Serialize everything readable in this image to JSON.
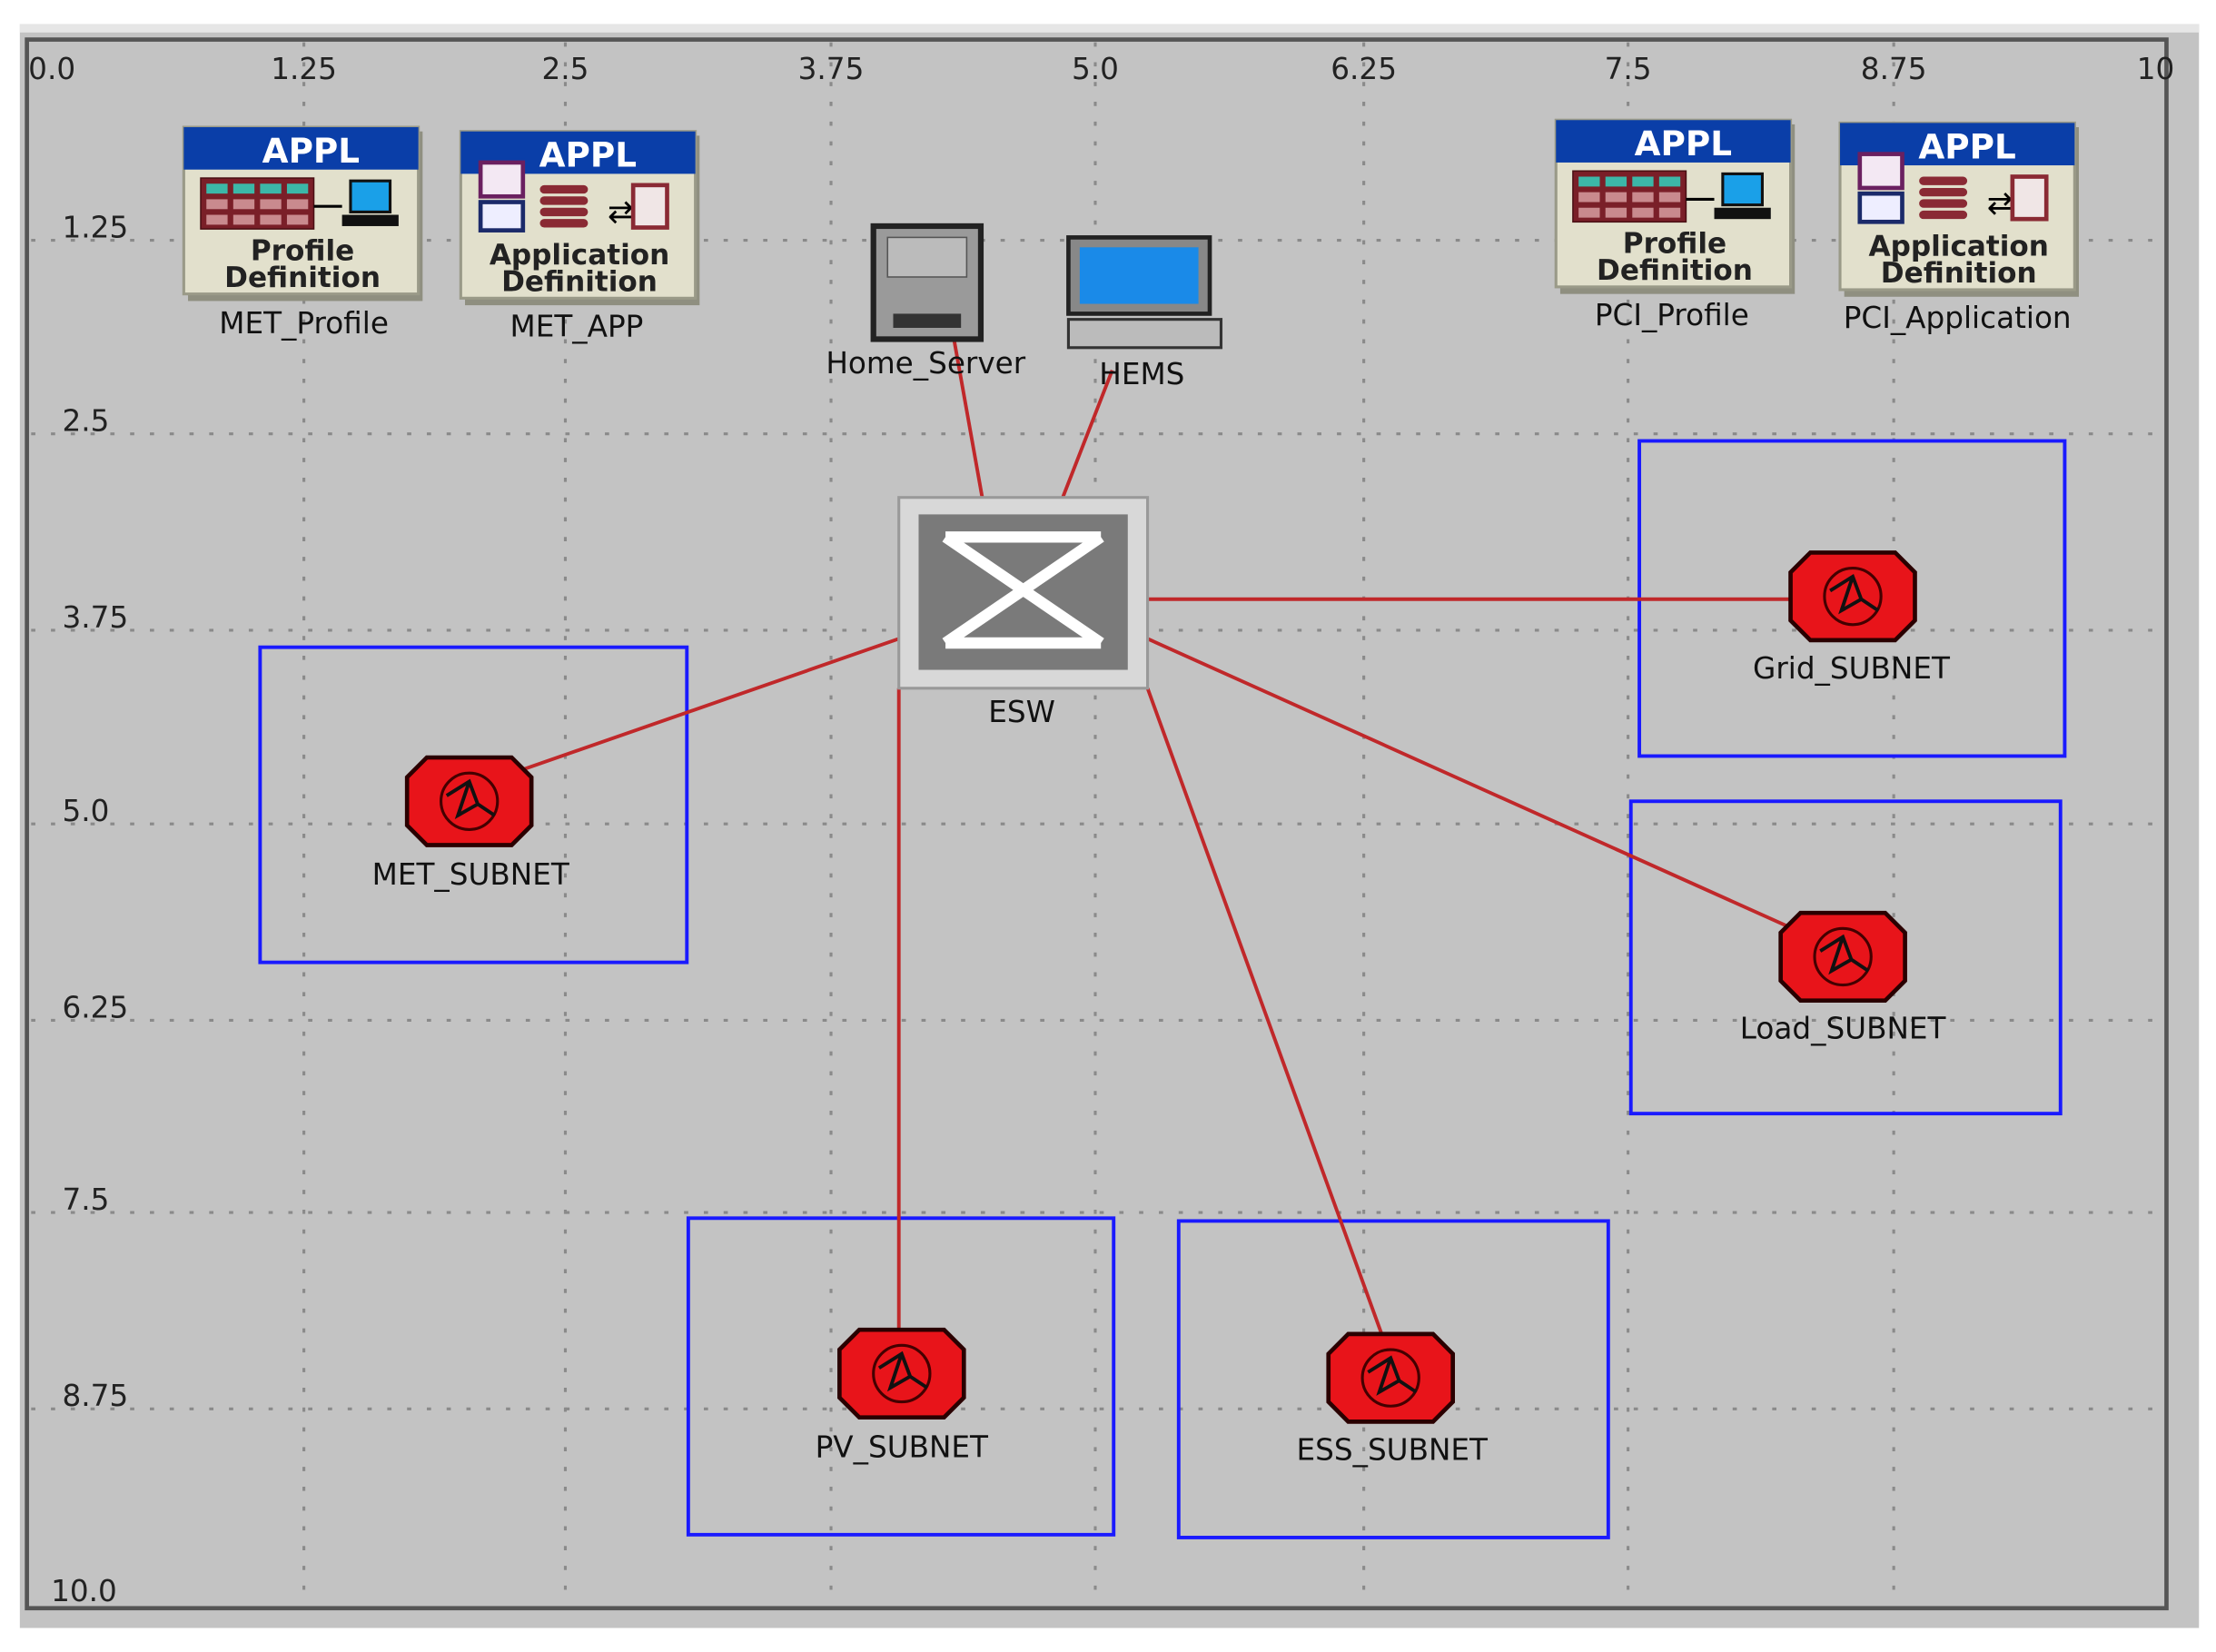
{
  "canvas": {
    "x_ticks": [
      "0.0",
      "1.25",
      "2.5",
      "3.75",
      "5.0",
      "6.25",
      "7.5",
      "8.75",
      "10"
    ],
    "y_ticks": [
      "1.25",
      "2.5",
      "3.75",
      "5.0",
      "6.25",
      "7.5",
      "8.75",
      "10.0"
    ]
  },
  "colors": {
    "background": "#c3c3c3",
    "link": "#c0282a",
    "subnet_box": "#1a1aff",
    "appl_header": "#0a3ea8",
    "router": "#e8141a"
  },
  "nodes": [
    {
      "id": "met_profile",
      "type": "appl",
      "badge": "APPL",
      "line1": "Profile",
      "line2": "Definition",
      "label": "MET_Profile",
      "icon": "profile-definition-icon"
    },
    {
      "id": "met_app",
      "type": "appl",
      "badge": "APPL",
      "line1": "Application",
      "line2": "Definition",
      "label": "MET_APP",
      "icon": "application-definition-icon"
    },
    {
      "id": "pci_profile",
      "type": "appl",
      "badge": "APPL",
      "line1": "Profile",
      "line2": "Definition",
      "label": "PCI_Profile",
      "icon": "profile-definition-icon"
    },
    {
      "id": "pci_application",
      "type": "appl",
      "badge": "APPL",
      "line1": "Application",
      "line2": "Definition",
      "label": "PCI_Application",
      "icon": "application-definition-icon"
    },
    {
      "id": "home_server",
      "type": "server",
      "label": "Home_Server",
      "icon": "server-icon"
    },
    {
      "id": "hems",
      "type": "workstation",
      "label": "HEMS",
      "icon": "workstation-icon"
    },
    {
      "id": "esw",
      "type": "switch",
      "label": "ESW",
      "icon": "ethernet-switch-icon"
    },
    {
      "id": "met_subnet",
      "type": "subnet",
      "label": "MET_SUBNET",
      "icon": "subnet-icon"
    },
    {
      "id": "grid_subnet",
      "type": "subnet",
      "label": "Grid_SUBNET",
      "icon": "subnet-icon"
    },
    {
      "id": "load_subnet",
      "type": "subnet",
      "label": "Load_SUBNET",
      "icon": "subnet-icon"
    },
    {
      "id": "pv_subnet",
      "type": "subnet",
      "label": "PV_SUBNET",
      "icon": "subnet-icon"
    },
    {
      "id": "ess_subnet",
      "type": "subnet",
      "label": "ESS_SUBNET",
      "icon": "subnet-icon"
    }
  ],
  "links": [
    {
      "from": "home_server",
      "to": "esw"
    },
    {
      "from": "hems",
      "to": "esw"
    },
    {
      "from": "esw",
      "to": "grid_subnet"
    },
    {
      "from": "esw",
      "to": "met_subnet"
    },
    {
      "from": "esw",
      "to": "load_subnet"
    },
    {
      "from": "esw",
      "to": "pv_subnet"
    },
    {
      "from": "esw",
      "to": "ess_subnet"
    }
  ]
}
